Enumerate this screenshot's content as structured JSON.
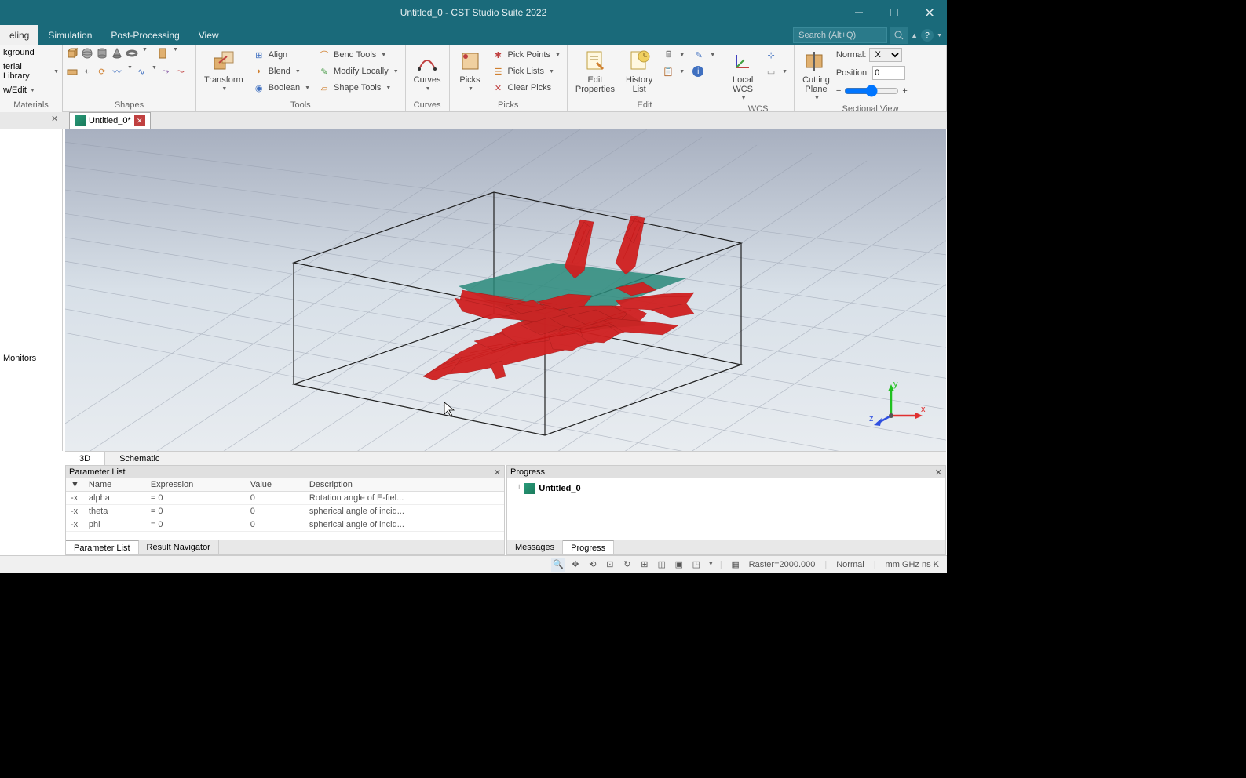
{
  "window": {
    "title": "Untitled_0 - CST Studio Suite 2022"
  },
  "menu_tabs": [
    "eling",
    "Simulation",
    "Post-Processing",
    "View"
  ],
  "active_menu_tab": 0,
  "search_placeholder": "Search (Alt+Q)",
  "left_sidebar": {
    "items": [
      "kground",
      "terial Library",
      "w/Edit"
    ],
    "group_label": "Materials"
  },
  "ribbon": {
    "shapes": {
      "label": "Shapes"
    },
    "tools": {
      "label": "Tools",
      "transform": "Transform",
      "align": "Align",
      "blend": "Blend",
      "boolean": "Boolean",
      "bend_tools": "Bend Tools",
      "modify_locally": "Modify Locally",
      "shape_tools": "Shape Tools"
    },
    "curves": {
      "label": "Curves",
      "curves": "Curves"
    },
    "picks": {
      "label": "Picks",
      "picks": "Picks",
      "pick_points": "Pick Points",
      "pick_lists": "Pick Lists",
      "clear_picks": "Clear Picks"
    },
    "edit": {
      "label": "Edit",
      "edit_properties": "Edit\nProperties",
      "history_list": "History\nList"
    },
    "wcs": {
      "label": "WCS",
      "local_wcs": "Local\nWCS"
    },
    "sectional": {
      "label": "Sectional View",
      "cutting_plane": "Cutting\nPlane",
      "normal_label": "Normal:",
      "normal_value": "X",
      "position_label": "Position:",
      "position_value": "0"
    }
  },
  "doc_tab": {
    "name": "Untitled_0*"
  },
  "tree": {
    "monitors": "Monitors"
  },
  "view_tabs": [
    "3D",
    "Schematic"
  ],
  "active_view_tab": 0,
  "param_panel": {
    "title": "Parameter List",
    "headers": [
      "Name",
      "Expression",
      "Value",
      "Description"
    ],
    "rows": [
      {
        "name": "alpha",
        "expression": "= 0",
        "value": "0",
        "description": "Rotation angle of E-fiel..."
      },
      {
        "name": "theta",
        "expression": "= 0",
        "value": "0",
        "description": "spherical angle of incid..."
      },
      {
        "name": "phi",
        "expression": "= 0",
        "value": "0",
        "description": "spherical angle of incid..."
      }
    ],
    "tabs": [
      "Parameter List",
      "Result Navigator"
    ]
  },
  "progress_panel": {
    "title": "Progress",
    "item": "Untitled_0",
    "tabs": [
      "Messages",
      "Progress"
    ]
  },
  "statusbar": {
    "raster": "Raster=2000.000",
    "normal": "Normal",
    "units": "mm  GHz  ns  K"
  },
  "axis": {
    "x": "x",
    "y": "y",
    "z": "z"
  }
}
